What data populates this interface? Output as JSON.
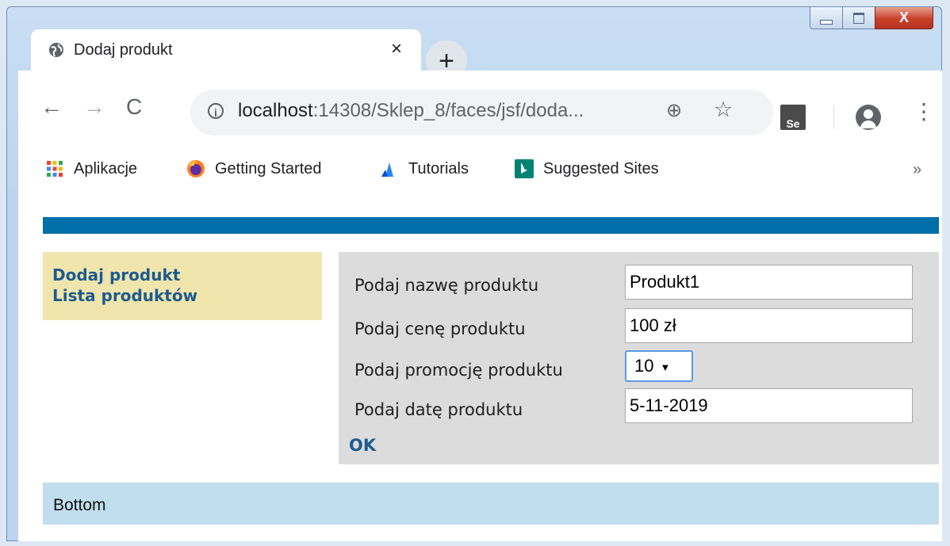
{
  "window": {
    "close_label": "X"
  },
  "tab": {
    "title": "Dodaj produkt",
    "close_label": "×",
    "new_tab_label": "+"
  },
  "toolbar": {
    "back": "←",
    "forward": "→",
    "reload": "C",
    "url_host": "localhost",
    "url_rest": ":14308/Sklep_8/faces/jsf/doda...",
    "info_label": "i",
    "zoom_icon": "⊕",
    "star_icon": "☆",
    "se_label": "Se",
    "menu_label": "⋮"
  },
  "bookmarks": {
    "items": [
      {
        "label": "Aplikacje",
        "icon": "apps-grid-icon"
      },
      {
        "label": "Getting Started",
        "icon": "firefox-icon"
      },
      {
        "label": "Tutorials",
        "icon": "atlassian-icon"
      },
      {
        "label": "Suggested Sites",
        "icon": "bing-icon"
      }
    ],
    "more_label": "»"
  },
  "page": {
    "menu": [
      {
        "label": "Dodaj produkt"
      },
      {
        "label": "Lista produktów"
      }
    ],
    "form": {
      "name_label": "Podaj nazwę produktu",
      "name_value": "Produkt1",
      "price_label": "Podaj cenę produktu",
      "price_value": "100 zł",
      "promo_label": "Podaj promocję produktu",
      "promo_value": "10",
      "date_label": "Podaj datę produktu",
      "date_value": "5-11-2019",
      "submit_label": "OK"
    },
    "footer": "Bottom"
  },
  "colors": {
    "top_bar": "#006ea8",
    "menu_bg": "#efe5ad",
    "form_bg": "#dcdcdc",
    "footer_bg": "#c1deee",
    "link": "#1d5b8f"
  }
}
